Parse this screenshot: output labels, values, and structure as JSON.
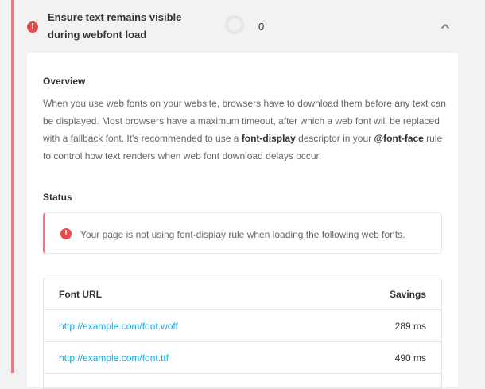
{
  "audit": {
    "title": "Ensure text remains visible during webfont load",
    "score": "0",
    "collapse_icon": "chevron-up-icon",
    "status_icon": "error-icon"
  },
  "overview": {
    "heading": "Overview",
    "text_1": "When you use web fonts on your website, browsers have to download them before any text can be displayed. Most browsers have a maximum timeout, after which a web font will be replaced with a fallback font. It's recommended to use a ",
    "code_1": "font-display",
    "text_2": " descriptor in your ",
    "code_2": "@font-face",
    "text_3": " rule to control how text renders when web font download delays occur."
  },
  "status": {
    "heading": "Status",
    "notice": "Your page is not using font-display rule when loading the following web fonts."
  },
  "table": {
    "headers": {
      "url": "Font URL",
      "savings": "Savings"
    },
    "rows": [
      {
        "url": "http://example.com/font.woff",
        "savings": "289 ms"
      },
      {
        "url": "http://example.com/font.ttf",
        "savings": "490 ms"
      }
    ]
  },
  "colors": {
    "error": "#e94b4b",
    "accent_border": "#f2777a",
    "link": "#17a8e3",
    "background": "#f2f2f2"
  }
}
